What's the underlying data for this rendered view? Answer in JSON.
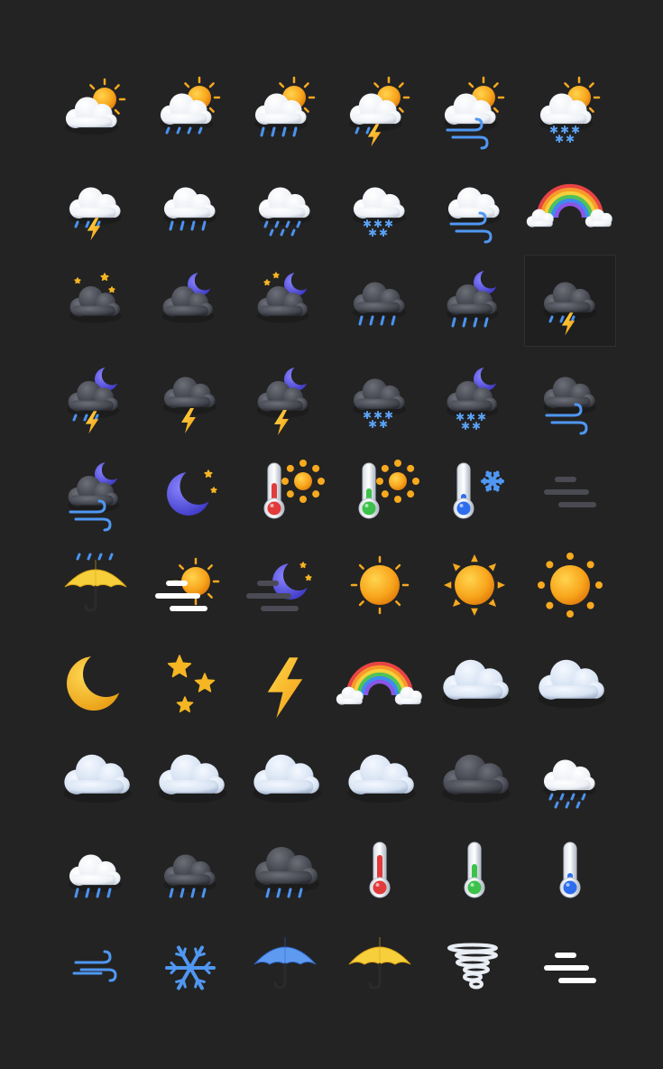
{
  "sheet": {
    "background": "#232323",
    "icons": [
      [
        {
          "name": "partly-cloudy-day-icon"
        },
        {
          "name": "partly-cloudy-rain-icon"
        },
        {
          "name": "partly-cloudy-heavy-rain-icon"
        },
        {
          "name": "partly-cloudy-thunder-icon"
        },
        {
          "name": "partly-cloudy-wind-icon"
        },
        {
          "name": "partly-cloudy-snow-icon"
        }
      ],
      [
        {
          "name": "cloud-thunder-rain-icon"
        },
        {
          "name": "cloud-heavy-rain-icon"
        },
        {
          "name": "cloud-rain-icon"
        },
        {
          "name": "cloud-snow-icon"
        },
        {
          "name": "cloud-wind-icon"
        },
        {
          "name": "rainbow-icon"
        }
      ],
      [
        {
          "name": "night-cloud-stars-icon"
        },
        {
          "name": "night-cloud-moon-icon"
        },
        {
          "name": "night-cloud-moon-stars-icon"
        },
        {
          "name": "dark-cloud-rain-icon"
        },
        {
          "name": "night-cloud-moon-rain-icon"
        },
        {
          "name": "dark-cloud-thunder-rain-icon",
          "selected": true
        }
      ],
      [
        {
          "name": "night-cloud-moon-thunder-rain-icon"
        },
        {
          "name": "dark-cloud-thunder-icon"
        },
        {
          "name": "night-cloud-moon-thunder-icon"
        },
        {
          "name": "dark-cloud-snow-icon"
        },
        {
          "name": "night-cloud-moon-snow-icon"
        },
        {
          "name": "dark-cloud-wind-icon"
        }
      ],
      [
        {
          "name": "night-cloud-moon-wind-icon"
        },
        {
          "name": "crescent-moon-stars-icon"
        },
        {
          "name": "thermometer-hot-sun-icon"
        },
        {
          "name": "thermometer-warm-sun-icon"
        },
        {
          "name": "thermometer-cold-snowflake-icon"
        },
        {
          "name": "dark-fog-icon"
        }
      ],
      [
        {
          "name": "umbrella-rain-icon"
        },
        {
          "name": "sun-haze-icon"
        },
        {
          "name": "moon-haze-icon"
        },
        {
          "name": "sun-icon"
        },
        {
          "name": "sun-triangle-rays-icon"
        },
        {
          "name": "sun-dot-rays-icon"
        }
      ],
      [
        {
          "name": "golden-moon-icon"
        },
        {
          "name": "stars-icon"
        },
        {
          "name": "lightning-icon"
        },
        {
          "name": "rainbow-icon"
        },
        {
          "name": "cloud-icon"
        },
        {
          "name": "cloud-icon"
        }
      ],
      [
        {
          "name": "cloud-icon"
        },
        {
          "name": "cloud-icon"
        },
        {
          "name": "cloud-icon"
        },
        {
          "name": "cloud-icon"
        },
        {
          "name": "dark-cloud-icon"
        },
        {
          "name": "cloud-rain-icon"
        }
      ],
      [
        {
          "name": "cloud-heavy-rain-icon"
        },
        {
          "name": "dark-cloud-rain-icon"
        },
        {
          "name": "dark-cloud-heavy-rain-icon"
        },
        {
          "name": "thermometer-hot-icon"
        },
        {
          "name": "thermometer-warm-icon"
        },
        {
          "name": "thermometer-cold-icon"
        }
      ],
      [
        {
          "name": "wind-icon"
        },
        {
          "name": "snowflake-icon"
        },
        {
          "name": "blue-umbrella-icon"
        },
        {
          "name": "yellow-umbrella-icon"
        },
        {
          "name": "tornado-icon"
        },
        {
          "name": "fog-icon"
        }
      ]
    ]
  }
}
